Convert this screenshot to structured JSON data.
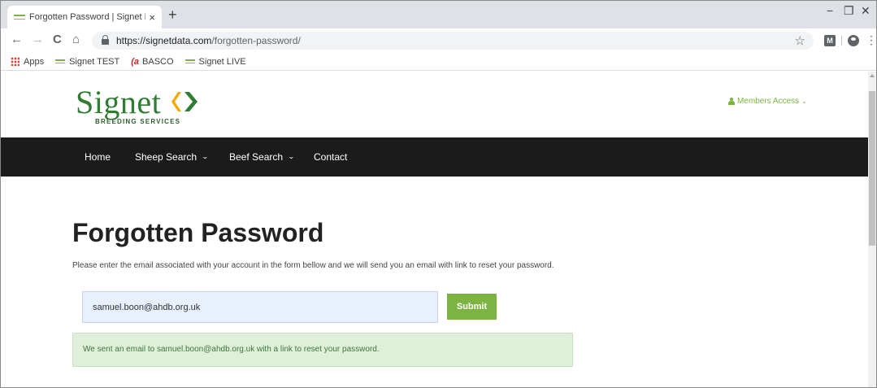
{
  "browser": {
    "tab_title": "Forgotten Password | Signet Brec",
    "tab_close": "×",
    "new_tab": "+",
    "window_controls": [
      "−",
      "❐",
      "✕"
    ],
    "nav": {
      "back": "←",
      "forward": "→",
      "reload": "C",
      "home": "⌂"
    },
    "url_host": "https://signetdata.com",
    "url_path": "/forgotten-password/",
    "star": "☆",
    "extension_label": "M",
    "menu": "⋮",
    "bookmarks": [
      {
        "label": "Apps",
        "icon": "apps-grid-icon"
      },
      {
        "label": "Signet TEST",
        "icon": "signet-favicon-icon"
      },
      {
        "label": "BASCO",
        "icon": "basco-favicon-icon"
      },
      {
        "label": "Signet LIVE",
        "icon": "signet-favicon-icon"
      }
    ],
    "basco_glyph": "(a"
  },
  "site": {
    "logo_word": "Signet",
    "logo_tagline": "BREEDING SERVICES",
    "members_access": "Members Access",
    "members_chevron": "⌄",
    "nav": [
      {
        "label": "Home",
        "dropdown": false
      },
      {
        "label": "Sheep Search",
        "dropdown": true
      },
      {
        "label": "Beef Search",
        "dropdown": true
      },
      {
        "label": "Contact",
        "dropdown": false
      }
    ],
    "dropdown_glyph": "⌄"
  },
  "main": {
    "title": "Forgotten Password",
    "intro": "Please enter the email associated with your account in the form bellow and we will send you an email with link to reset your password.",
    "email_value": "samuel.boon@ahdb.org.uk",
    "submit_label": "Submit",
    "success_message": "We sent an email to samuel.boon@ahdb.org.uk with a link to reset your password."
  },
  "colors": {
    "brand_green": "#2e7d32",
    "accent_green": "#7cb342",
    "navbar": "#1b1b1b",
    "alert_bg": "#dff0d8"
  }
}
